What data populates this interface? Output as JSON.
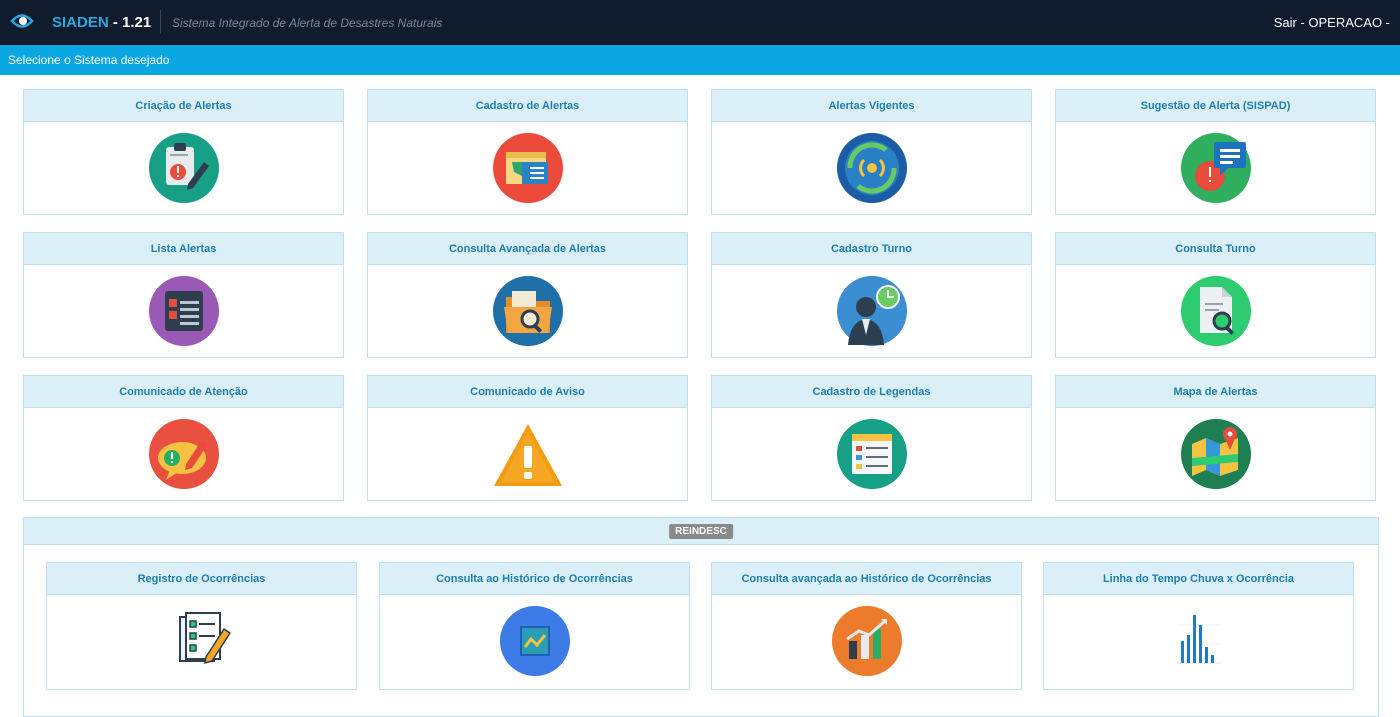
{
  "header": {
    "app_name": "SIADEN",
    "version": " - 1.21",
    "subtitle": "Sistema Integrado de Alerta de Desastres Naturais",
    "user_menu": "Sair - OPERACAO -"
  },
  "select_bar": {
    "text": "Selecione o Sistema desejado"
  },
  "cards": [
    {
      "title": "Criação de Alertas",
      "icon": "clipboard-alert-icon"
    },
    {
      "title": "Cadastro de Alertas",
      "icon": "alert-register-icon"
    },
    {
      "title": "Alertas Vigentes",
      "icon": "signal-broadcast-icon"
    },
    {
      "title": "Sugestão de Alerta (SISPAD)",
      "icon": "alert-suggestion-icon"
    },
    {
      "title": "Lista Alertas",
      "icon": "alert-list-icon"
    },
    {
      "title": "Consulta Avançada de Alertas",
      "icon": "folder-search-icon"
    },
    {
      "title": "Cadastro Turno",
      "icon": "operator-clock-icon"
    },
    {
      "title": "Consulta Turno",
      "icon": "document-search-icon"
    },
    {
      "title": "Comunicado de Atenção",
      "icon": "attention-message-icon"
    },
    {
      "title": "Comunicado de Aviso",
      "icon": "warning-triangle-icon"
    },
    {
      "title": "Cadastro de Legendas",
      "icon": "legend-table-icon"
    },
    {
      "title": "Mapa de Alertas",
      "icon": "alert-map-icon"
    }
  ],
  "reindesc": {
    "badge": "REINDESC",
    "cards": [
      {
        "title": "Registro de Ocorrências",
        "icon": "checklist-pencil-icon"
      },
      {
        "title": "Consulta ao Histórico de Ocorrências",
        "icon": "history-chart-icon"
      },
      {
        "title": "Consulta avançada ao Histórico de Ocorrências",
        "icon": "advanced-chart-icon"
      },
      {
        "title": "Linha do Tempo Chuva x Ocorrência",
        "icon": "rain-timeline-icon"
      }
    ]
  },
  "colors": {
    "topbar": "#101b2e",
    "select_bar": "#0aa7e3",
    "card_header": "#dbeff8",
    "card_title": "#1e7fae"
  }
}
